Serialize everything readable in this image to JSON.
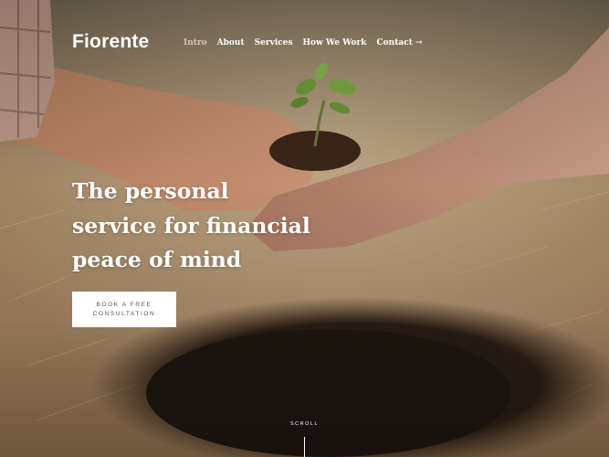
{
  "brand": {
    "name": "Fiorente"
  },
  "nav": {
    "items": [
      {
        "label": "Intro"
      },
      {
        "label": "About"
      },
      {
        "label": "Services"
      },
      {
        "label": "How We Work"
      },
      {
        "label": "Contact →"
      }
    ]
  },
  "hero": {
    "headline_lines": [
      "The personal",
      "service for financial",
      "peace of mind"
    ],
    "cta_lines": [
      "BOOK A FREE",
      "CONSULTATION"
    ],
    "scroll_label": "SCROLL",
    "image": "hands-holding-seedling-soil-photo"
  },
  "colors": {
    "nav_active": "#cfc6b4",
    "text": "#ffffff",
    "cta_bg": "#ffffff"
  }
}
